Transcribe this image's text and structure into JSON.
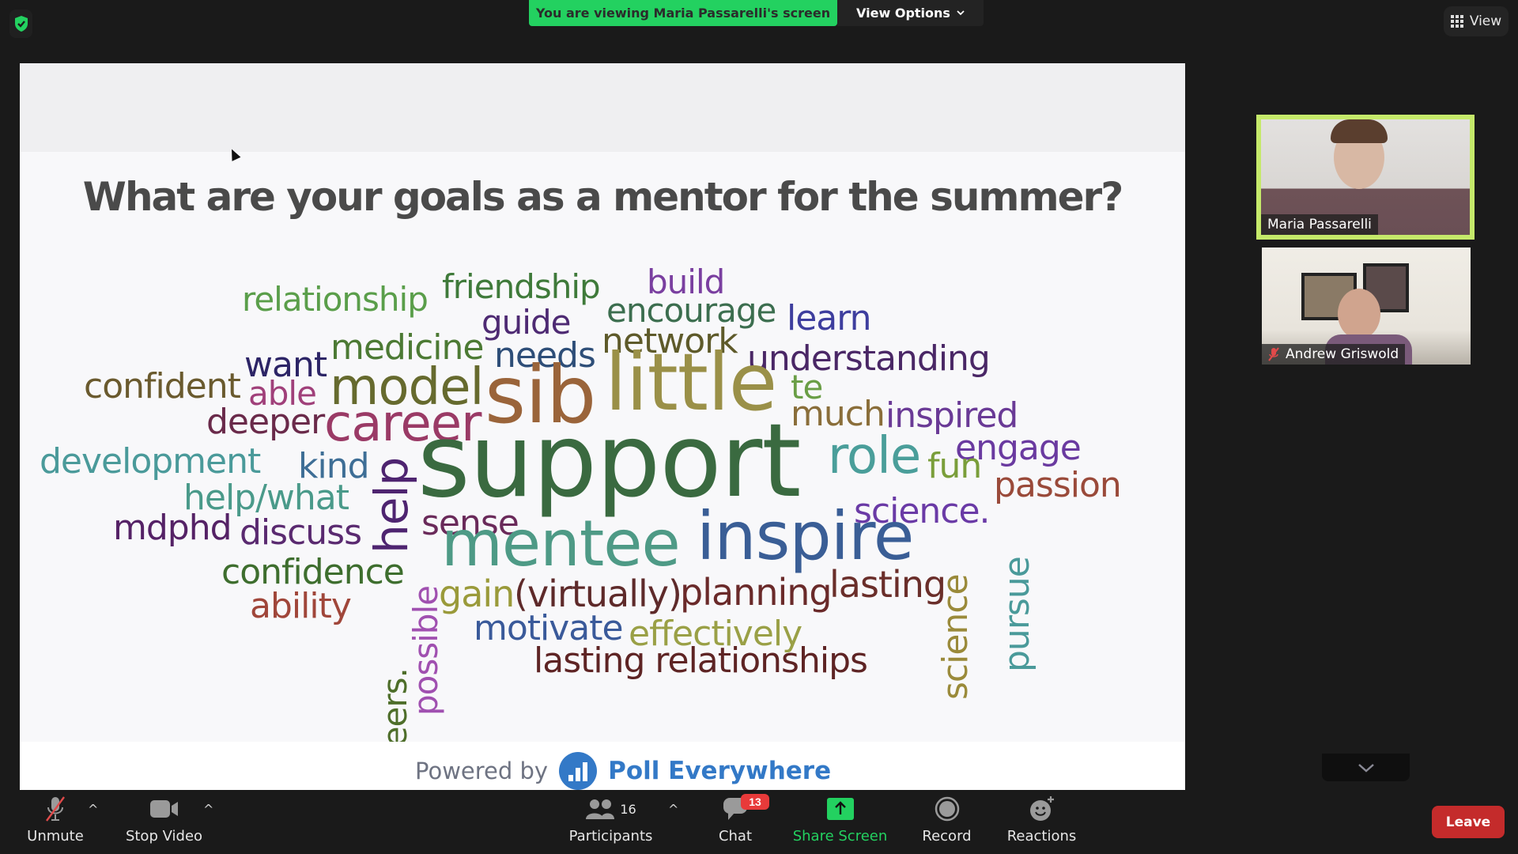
{
  "top_bar": {
    "security_icon": "shield-check-icon",
    "viewing_banner": "You are viewing Maria Passarelli's screen",
    "view_options_label": "View Options",
    "view_button_label": "View"
  },
  "slide": {
    "question": "What are your goals as a mentor for the summer?",
    "powered_by": "Powered by",
    "brand": "Poll Everywhere",
    "colors": {
      "brand": "#3379c7",
      "title": "#4a4a4a"
    },
    "word_cloud": [
      {
        "text": "relationship",
        "color": "#5a9e4a"
      },
      {
        "text": "friendship",
        "color": "#3f7a3a"
      },
      {
        "text": "build",
        "color": "#7a3fa0"
      },
      {
        "text": "guide",
        "color": "#4e2a73"
      },
      {
        "text": "encourage",
        "color": "#3c6e4f"
      },
      {
        "text": "learn",
        "color": "#3e3e9e"
      },
      {
        "text": "medicine",
        "color": "#4c7a34"
      },
      {
        "text": "needs",
        "color": "#2e4e78"
      },
      {
        "text": "network",
        "color": "#5e5a2a"
      },
      {
        "text": "want",
        "color": "#2c2466"
      },
      {
        "text": "understanding",
        "color": "#4a2766"
      },
      {
        "text": "confident",
        "color": "#6a5a2e"
      },
      {
        "text": "able",
        "color": "#a0407a"
      },
      {
        "text": "model",
        "color": "#666a2e"
      },
      {
        "text": "sib",
        "color": "#9a643a"
      },
      {
        "text": "little",
        "color": "#9a9048"
      },
      {
        "text": "te",
        "color": "#6a9e46"
      },
      {
        "text": "much",
        "color": "#8a6e3a"
      },
      {
        "text": "inspired",
        "color": "#6a3a96"
      },
      {
        "text": "deeper",
        "color": "#6a2a4a"
      },
      {
        "text": "career",
        "color": "#9a3a66"
      },
      {
        "text": "engage",
        "color": "#6a3aa0"
      },
      {
        "text": "development",
        "color": "#4a9a9a"
      },
      {
        "text": "kind",
        "color": "#3e6e96"
      },
      {
        "text": "help",
        "color": "#4e2470"
      },
      {
        "text": "support",
        "color": "#3a6a40"
      },
      {
        "text": "role",
        "color": "#4a9e9a"
      },
      {
        "text": "fun",
        "color": "#7a9e3a"
      },
      {
        "text": "passion",
        "color": "#9a4a3a"
      },
      {
        "text": "help/what",
        "color": "#4a9a8a"
      },
      {
        "text": "science.",
        "color": "#6a3aa6"
      },
      {
        "text": "mdphd",
        "color": "#552266"
      },
      {
        "text": "discuss",
        "color": "#5a2a70"
      },
      {
        "text": "sense",
        "color": "#6a2a5a"
      },
      {
        "text": "mentee",
        "color": "#4e9a86"
      },
      {
        "text": "inspire",
        "color": "#3a5e96"
      },
      {
        "text": "science",
        "color": "#9a8a3a"
      },
      {
        "text": "pursue",
        "color": "#4a9a9a"
      },
      {
        "text": "confidence",
        "color": "#3e6e2e"
      },
      {
        "text": "possible",
        "color": "#a050b0"
      },
      {
        "text": "gain",
        "color": "#9a9a3a"
      },
      {
        "text": "(virtually)",
        "color": "#5e2a2a"
      },
      {
        "text": "planning",
        "color": "#6a2a2a"
      },
      {
        "text": "lasting",
        "color": "#6a2e2a"
      },
      {
        "text": "ability",
        "color": "#a0463a"
      },
      {
        "text": "peers.",
        "color": "#4e6e2a"
      },
      {
        "text": "motivate",
        "color": "#3a5a9a"
      },
      {
        "text": "effectively",
        "color": "#9aa046"
      },
      {
        "text": "lasting relationships",
        "color": "#5e2424"
      }
    ]
  },
  "participants_videos": [
    {
      "name": "Maria Passarelli",
      "active_speaker": true,
      "muted": false
    },
    {
      "name": "Andrew Griswold",
      "active_speaker": false,
      "muted": true
    }
  ],
  "toolbar": {
    "unmute_label": "Unmute",
    "stop_video_label": "Stop Video",
    "participants_label": "Participants",
    "participants_count": "16",
    "chat_label": "Chat",
    "chat_badge": "13",
    "share_screen_label": "Share Screen",
    "record_label": "Record",
    "reactions_label": "Reactions",
    "leave_label": "Leave",
    "caret": "^",
    "colors": {
      "share": "#23d160",
      "leave": "#c42b2b",
      "badge": "#e83a3a"
    }
  }
}
